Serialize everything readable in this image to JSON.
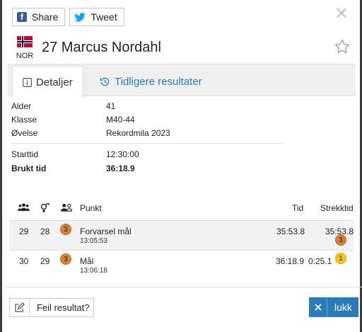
{
  "share": {
    "facebook_label": "Share",
    "facebook_icon": "facebook-icon",
    "twitter_label": "Tweet",
    "twitter_icon": "twitter-icon"
  },
  "athlete": {
    "country_code": "NOR",
    "flag_icon": "norway-flag-icon",
    "name": "27 Marcus Nordahl"
  },
  "tabs": [
    {
      "label": "Detaljer",
      "icon": "info-icon",
      "active": true
    },
    {
      "label": "Tidligere resultater",
      "icon": "history-icon",
      "active": false
    }
  ],
  "details": {
    "rows": [
      {
        "label": "Alder",
        "value": "41"
      },
      {
        "label": "Klasse",
        "value": "M40-44"
      },
      {
        "label": "Øvelse",
        "value": "Rekordmila 2023"
      }
    ],
    "rows2": [
      {
        "label": "Starttid",
        "value": "12:30:00"
      },
      {
        "label": "Brukt tid",
        "value": "36:18.9"
      }
    ]
  },
  "table": {
    "headers": {
      "overall_icon": "group-icon",
      "gender_icon": "gender-icon",
      "class_icon": "class-icon",
      "punkt": "Punkt",
      "tid": "Tid",
      "strekktid": "Strekktid"
    },
    "rows": [
      {
        "overall": "29",
        "gender": "28",
        "class_place": "3",
        "punkt": "Forvarsel mål",
        "clock": "13:05:53",
        "tid": "35:53.8",
        "strekktid": "35:53.8",
        "strekk_place": "3",
        "strekk_medal": "bronze"
      },
      {
        "overall": "30",
        "gender": "29",
        "class_place": "3",
        "punkt": "Mål",
        "clock": "13:06:18",
        "tid": "36:18.9",
        "strekktid": "0:25.1",
        "strekk_place": "1",
        "strekk_medal": "gold"
      }
    ]
  },
  "footer": {
    "wrong_result_label": "Feil resultat?",
    "close_label": "lukk"
  },
  "colors": {
    "accent": "#2a7bb8",
    "bronze": "#d8823a",
    "gold": "#f5c518"
  }
}
